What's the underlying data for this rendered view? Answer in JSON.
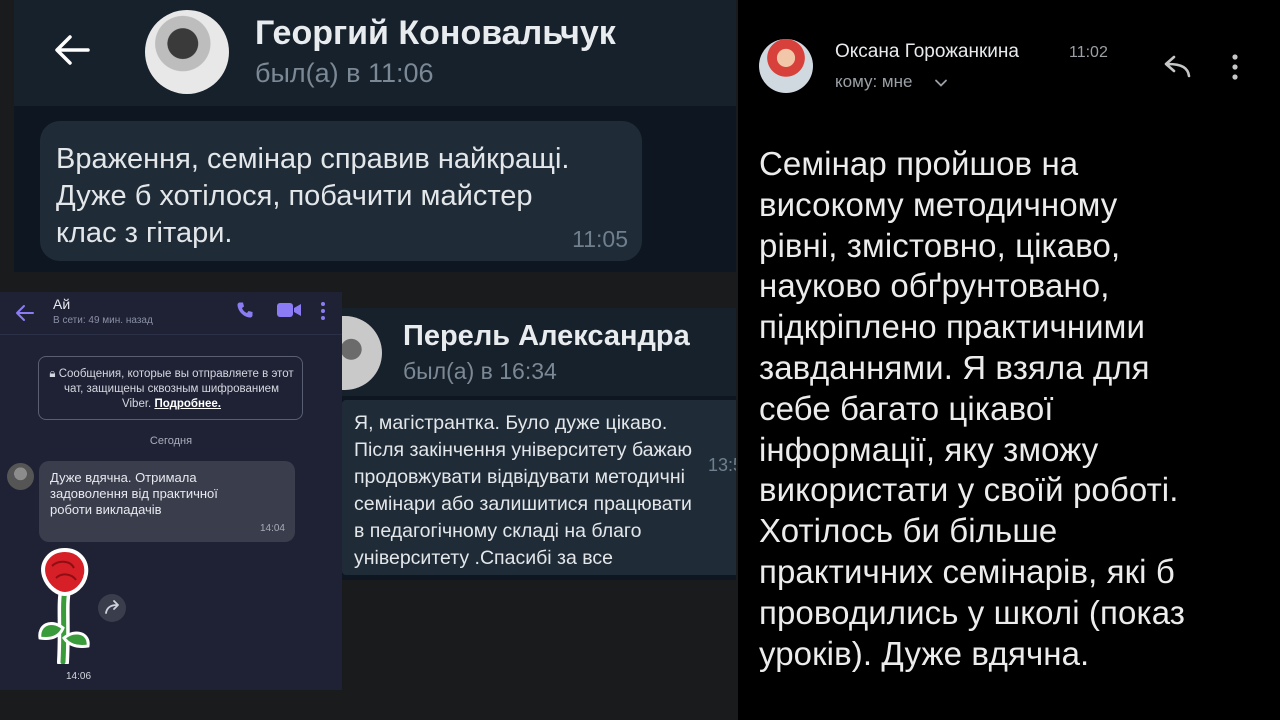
{
  "telegram_chat_1": {
    "contact_name": "Георгий Коновальчук",
    "status": "был(а) в 11:06",
    "message": {
      "text": "Враження, семінар справив найкращі.\nДуже б хотілося, побачити майстер\nклас з гітари.",
      "time": "11:05"
    }
  },
  "viber_chat": {
    "contact_name": "Ай",
    "status": "В сети: 49 мин. назад",
    "encryption_notice": "Сообщения, которые вы отправляете в этот чат, защищены сквозным шифрованием Viber.",
    "encryption_link": "Подробнее.",
    "date_separator": "Сегодня",
    "message": {
      "text": "Дуже вдячна. Отримала\nзадоволення від практичної\nроботи викладачів",
      "time": "14:04"
    },
    "sticker": {
      "icon": "rose-sticker",
      "time": "14:06"
    }
  },
  "telegram_chat_2": {
    "contact_name": "Перель Александра",
    "status": "был(а) в 16:34",
    "message": {
      "text": "Я, магістрантка. Було дуже цікаво.\nПісля закінчення університету бажаю\nпродовжувати відвідувати методичні\nсемінари або залишитися працювати\nв педагогічному складі на благо\nуніверситету .Спасибі за все",
      "time": "13:5"
    }
  },
  "email": {
    "sender": "Оксана Горожанкина",
    "time": "11:02",
    "recipient": "кому: мне",
    "body": "Семінар пройшов на\nвисокому методичному\nрівні, змістовно, цікаво,\nнауково обґрунтовано,\nпідкріплено практичними\nзавданнями. Я взяла для\nсебе багато цікавої\nінформації, яку зможу\nвикористати у своїй роботі.\nХотілось би більше\nпрактичних семінарів, які б\nпроводились у школі (показ\nуроків). Дуже вдячна."
  },
  "colors": {
    "telegram_bg": "#0e1621",
    "telegram_header": "#17212b",
    "telegram_bubble": "#1f2c38",
    "viber_bg": "#1f2234",
    "viber_accent": "#7c6cf2",
    "gmail_bg": "#000000"
  }
}
